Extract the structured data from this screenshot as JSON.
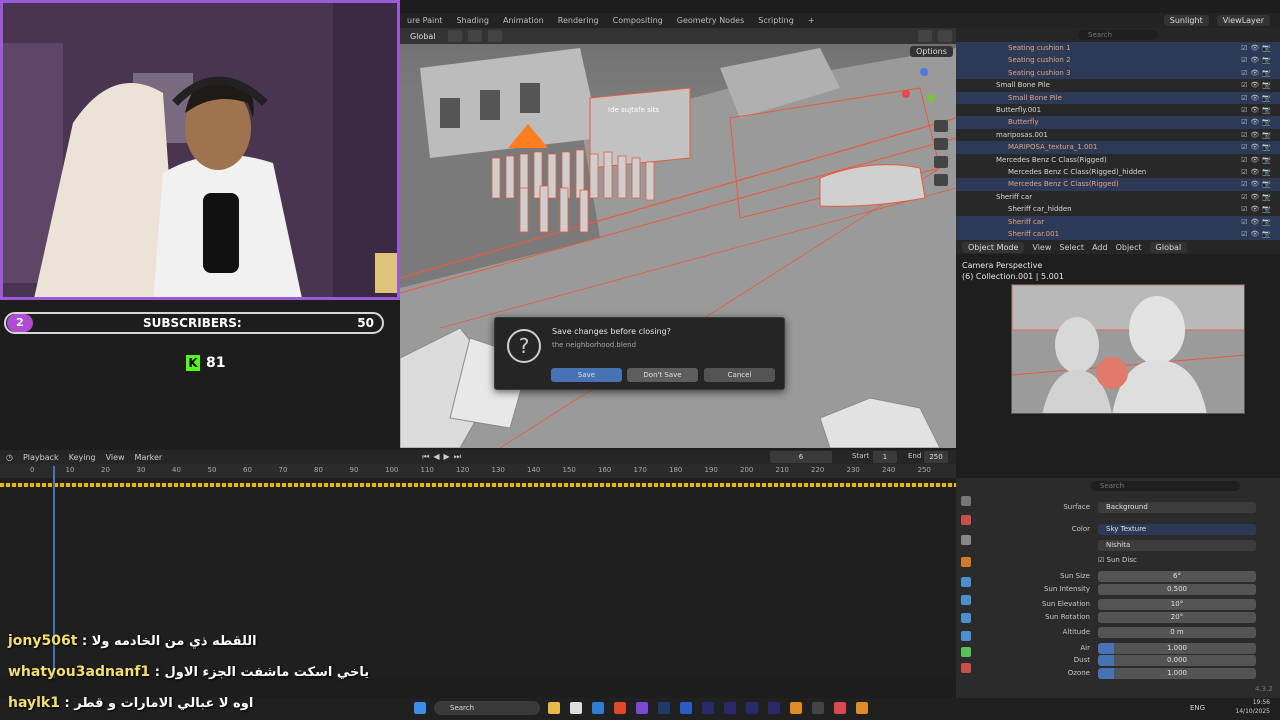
{
  "menubar": {
    "tabs": [
      "ure Paint",
      "Shading",
      "Animation",
      "Rendering",
      "Compositing",
      "Geometry Nodes",
      "Scripting",
      "+"
    ],
    "scene": "Sunlight",
    "view_layer": "ViewLayer"
  },
  "viewport": {
    "transform": "Global",
    "options": "Options",
    "overlay_label": "Ide sujtafe sits"
  },
  "subscribers": {
    "count_badge": "2",
    "label": "SUBSCRIBERS:",
    "value": "50"
  },
  "kick": {
    "icon": "K",
    "viewers": "81"
  },
  "dialog": {
    "title": "Save changes before closing?",
    "filename": "the neighborhood.blend",
    "save": "Save",
    "dont_save": "Don't Save",
    "cancel": "Cancel"
  },
  "timeline": {
    "menus": [
      "Playback",
      "Keying",
      "View",
      "Marker"
    ],
    "current_frame": "6",
    "start_label": "Start",
    "start": "1",
    "end_label": "End",
    "end": "250",
    "ticks": [
      "0",
      "10",
      "20",
      "30",
      "40",
      "50",
      "60",
      "70",
      "80",
      "90",
      "100",
      "110",
      "120",
      "130",
      "140",
      "150",
      "160",
      "170",
      "180",
      "190",
      "200",
      "210",
      "220",
      "230",
      "240",
      "250"
    ]
  },
  "outliner": {
    "search_placeholder": "Search",
    "rows": [
      {
        "label": "Seating cushion 1",
        "indent": 2,
        "selected": true
      },
      {
        "label": "Seating cushion 2",
        "indent": 2,
        "selected": true
      },
      {
        "label": "Seating cushion 3",
        "indent": 2,
        "selected": true
      },
      {
        "label": "Small Bone Pile",
        "indent": 1,
        "selected": false
      },
      {
        "label": "Small Bone Pile",
        "indent": 2,
        "selected": true
      },
      {
        "label": "Butterfly.001",
        "indent": 1,
        "selected": false
      },
      {
        "label": "Butterfly",
        "indent": 2,
        "selected": true
      },
      {
        "label": "mariposas.001",
        "indent": 1,
        "selected": false
      },
      {
        "label": "MARIPOSA_textura_1.001",
        "indent": 2,
        "selected": true
      },
      {
        "label": "Mercedes Benz C Class(Rigged)",
        "indent": 1,
        "selected": false
      },
      {
        "label": "Mercedes Benz C Class(Rigged)_hidden",
        "indent": 2,
        "selected": false
      },
      {
        "label": "Mercedes Benz C Class(Rigged)",
        "indent": 2,
        "selected": true
      },
      {
        "label": "Sheriff car",
        "indent": 1,
        "selected": false
      },
      {
        "label": "Sheriff car_hidden",
        "indent": 2,
        "selected": false
      },
      {
        "label": "Sheriff car",
        "indent": 2,
        "selected": true
      },
      {
        "label": "Sheriff car.001",
        "indent": 2,
        "selected": true
      }
    ]
  },
  "camera_panel": {
    "mode": "Object Mode",
    "menus": [
      "View",
      "Select",
      "Add",
      "Object"
    ],
    "transform": "Global",
    "title": "Camera Perspective",
    "subtitle": "(6) Collection.001 | 5.001"
  },
  "properties": {
    "search_placeholder": "Search",
    "surface_label": "Surface",
    "surface": "Background",
    "color_label": "Color",
    "color": "Sky Texture",
    "sky_type": "Nishita",
    "sun_disc": "Sun Disc",
    "fields": [
      {
        "label": "Sun Size",
        "value": "6°"
      },
      {
        "label": "Sun Intensity",
        "value": "0.500"
      },
      {
        "label": "Sun Elevation",
        "value": "10°"
      },
      {
        "label": "Sun Rotation",
        "value": "20°"
      },
      {
        "label": "Altitude",
        "value": "0 m"
      },
      {
        "label": "Air",
        "value": "1.000"
      },
      {
        "label": "Dust",
        "value": "0.000"
      },
      {
        "label": "Ozone",
        "value": "1.000"
      }
    ],
    "version": "4.3.2"
  },
  "chat": [
    {
      "user": "jony506t",
      "message": "اللقطه ذي من الخادمه ولا"
    },
    {
      "user": "whatyou3adnanf1",
      "message": "ياخي اسكت ماشفت الجزء الاول"
    },
    {
      "user": "haylk1",
      "message": "اوه لا عبالي الامارات و قطر"
    }
  ],
  "taskbar": {
    "search": "Search",
    "lang": "ENG",
    "time": "19:56",
    "date": "14/10/2025"
  }
}
